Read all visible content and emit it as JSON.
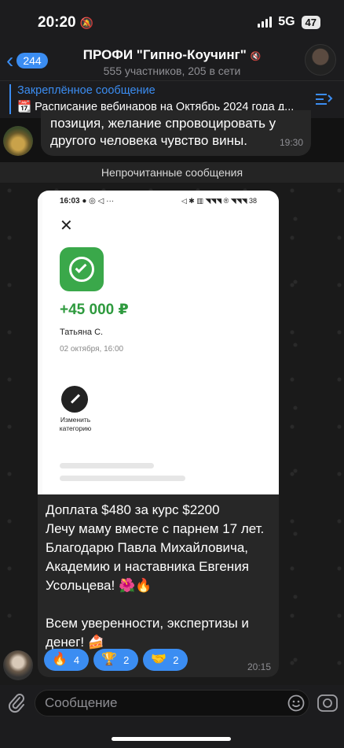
{
  "status_bar": {
    "time": "20:20",
    "network": "5G",
    "battery": "47",
    "mute_glyph": "🔕"
  },
  "header": {
    "back_count": "244",
    "title": "ПРОФИ \"Гипно-Коучинг\"",
    "mute_glyph": "🔇",
    "subtitle": "555 участников, 205 в сети"
  },
  "pinned": {
    "title": "Закреплённое сообщение",
    "text": "📆 Расписание вебинаров на Октябрь 2024 года д..."
  },
  "previous_message": {
    "text": "позиция, желание спровоцировать у\nдругого человека чувство вины.",
    "time": "19:30"
  },
  "unread_label": "Непрочитанные сообщения",
  "main_message": {
    "screenshot": {
      "status_time": "16:03",
      "status_glyphs": "● ◎ ◁ ···",
      "status_right": "◁ ✱ ▥ ◥◥◥ ® ◥◥◥ 38",
      "close_glyph": "✕",
      "amount": "+45 000 ₽",
      "payer": "Татьяна С.",
      "date": "02 октября, 16:00",
      "edit_category_label": "Изменить категорию"
    },
    "text": "Доплата $480 за курс $2200\nЛечу маму вместе с парнем 17 лет.\nБлагодарю Павла Михайловича,\nАкадемию и наставника Евгения\nУсольцева! 🌺🔥\n\nВсем уверенности, экспертизы и\nденег! 🍰",
    "reactions": [
      {
        "emoji": "🔥",
        "count": "4"
      },
      {
        "emoji": "🏆",
        "count": "2"
      },
      {
        "emoji": "🤝",
        "count": "2"
      }
    ],
    "time": "20:15"
  },
  "input": {
    "placeholder": "Сообщение"
  },
  "colors": {
    "accent": "#3b8df2",
    "bubble": "#272727",
    "amount_green": "#2e9a3e",
    "app_icon_green": "#3aa84a"
  },
  "icons": [
    "back-chevron-icon",
    "mute-icon",
    "pinned-list-icon",
    "close-icon",
    "check-circle-icon",
    "pencil-icon",
    "attach-icon",
    "sticker-icon",
    "camera-icon"
  ]
}
